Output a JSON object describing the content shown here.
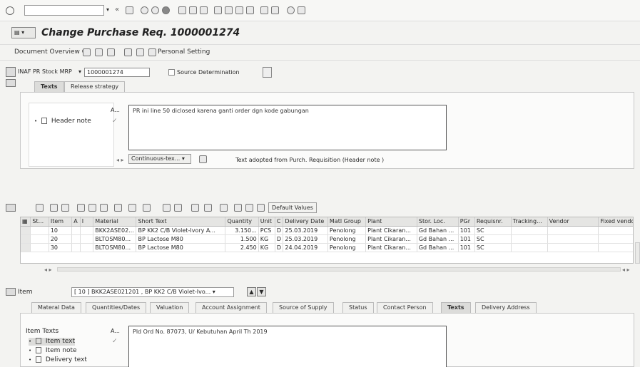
{
  "header": {
    "title": "Change Purchase Req. 1000001274"
  },
  "appbar": {
    "doc_overview": "Document Overview On",
    "personal_setting": "Personal Setting"
  },
  "req_header": {
    "doc_type": "INAF PR Stock MRP",
    "doc_number": "1000001274",
    "source_determination": "Source Determination"
  },
  "header_tabs": [
    "Texts",
    "Release strategy"
  ],
  "header_texts": {
    "col_a": "A...",
    "items": [
      "Header note"
    ],
    "content": "PR ini line 50 diclosed karena ganti order dgn kode gabungan",
    "format": "Continuous-tex...",
    "adopted_note": "Text adopted from Purch. Requisition (Header note )"
  },
  "items_grid": {
    "default_values": "Default Values",
    "columns": [
      "St...",
      "Item",
      "A",
      "I",
      "Material",
      "Short Text",
      "Quantity",
      "Unit",
      "C",
      "Delivery Date",
      "Matl Group",
      "Plant",
      "Stor. Loc.",
      "PGr",
      "Requisnr.",
      "Tracking...",
      "Vendor",
      "Fixed vendo"
    ],
    "rows": [
      [
        "",
        "10",
        "",
        "",
        "BKK2ASE02...",
        "BP KK2 C/B Violet-Ivory A...",
        "3.150...",
        "PCS",
        "D",
        "25.03.2019",
        "Penolong",
        "Plant Cikaran...",
        "Gd Bahan ...",
        "101",
        "SC",
        "",
        "",
        ""
      ],
      [
        "",
        "20",
        "",
        "",
        "BLTOSM80...",
        "BP Lactose M80",
        "1.500",
        "KG",
        "D",
        "25.03.2019",
        "Penolong",
        "Plant Cikaran...",
        "Gd Bahan ...",
        "101",
        "SC",
        "",
        "",
        ""
      ],
      [
        "",
        "30",
        "",
        "",
        "BLTOSM80...",
        "BP Lactose M80",
        "2.450",
        "KG",
        "D",
        "24.04.2019",
        "Penolong",
        "Plant Cikaran...",
        "Gd Bahan ...",
        "101",
        "SC",
        "",
        "",
        ""
      ]
    ]
  },
  "item_detail": {
    "label": "Item",
    "selected_item": "[ 10 ] BKK2ASE021201 , BP KK2 C/B Violet-Ivo...",
    "tabs": [
      "Materal Data",
      "Quantities/Dates",
      "Valuation",
      "Account Assignment",
      "Source of Supply",
      "Status",
      "Contact Person",
      "Texts",
      "Delivery Address"
    ],
    "active_tab": "Texts",
    "texts_title": "Item Texts",
    "col_a": "A...",
    "items": [
      "Item text",
      "Item note",
      "Delivery text"
    ],
    "content": "Pld Ord No. 87073, U/ Kebutuhan April Th 2019"
  }
}
